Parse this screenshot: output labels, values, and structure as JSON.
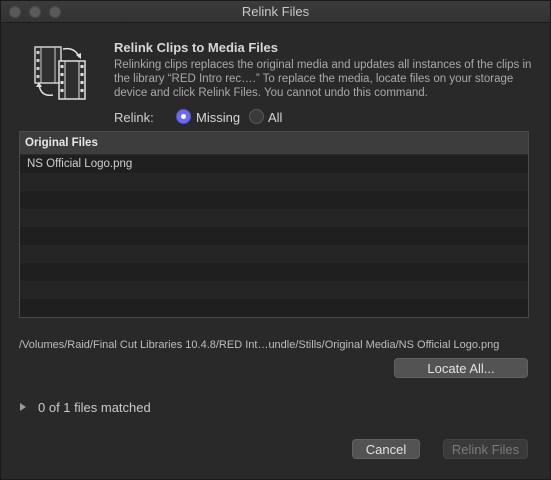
{
  "window": {
    "title": "Relink Files"
  },
  "icons": {
    "app": "relink-clips-icon",
    "disclosure": "disclosure-triangle-icon"
  },
  "header": {
    "heading": "Relink Clips to Media Files",
    "description": "Relinking clips replaces the original media and updates all instances of the clips in the library “RED Intro rec….” To replace the media, locate files on your storage device and click Relink Files. You cannot undo this command."
  },
  "relink": {
    "label": "Relink:",
    "options": [
      {
        "label": "Missing",
        "selected": true
      },
      {
        "label": "All",
        "selected": false
      }
    ]
  },
  "list": {
    "header": "Original Files",
    "rows": [
      "NS Official Logo.png",
      "",
      "",
      "",
      "",
      "",
      "",
      "",
      ""
    ]
  },
  "path": "/Volumes/Raid/Final Cut Libraries 10.4.8/RED Int…undle/Stills/Original Media/NS Official Logo.png",
  "buttons": {
    "locate_all": "Locate All...",
    "cancel": "Cancel",
    "relink_files": "Relink Files"
  },
  "status": {
    "matched": "0 of 1 files matched"
  },
  "colors": {
    "accent": "#6a6af0",
    "background": "#292929"
  }
}
